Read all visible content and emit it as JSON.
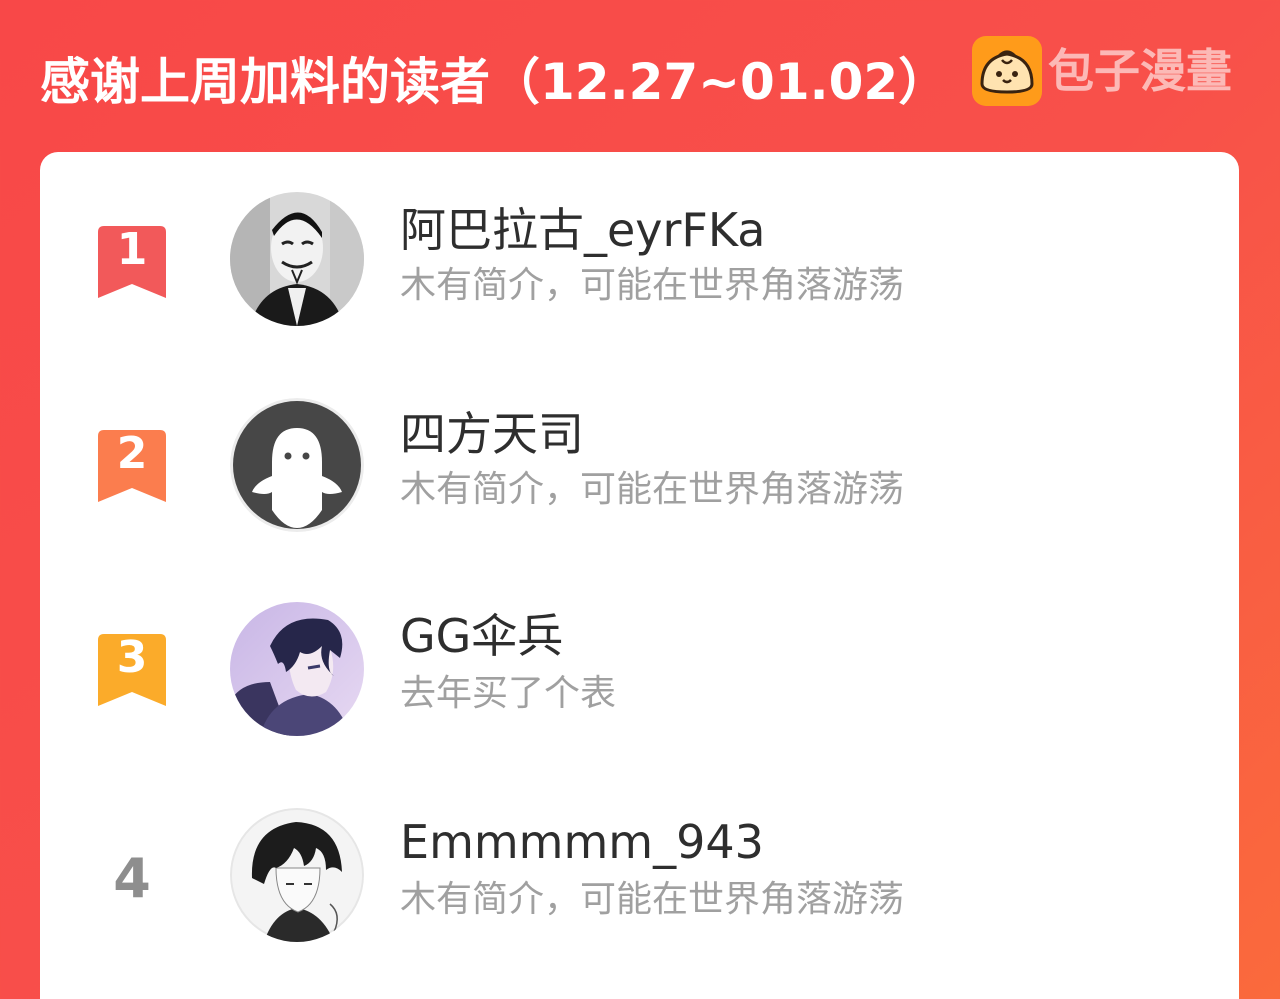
{
  "header": {
    "title": "感谢上周加料的读者（12.27~01.02）",
    "brand_name": "包子漫畫"
  },
  "readers": [
    {
      "rank": "1",
      "name": "阿巴拉古_eyrFKa",
      "bio": "木有简介，可能在世界角落游荡",
      "badge_color": "#f2595a"
    },
    {
      "rank": "2",
      "name": "四方天司",
      "bio": "木有简介，可能在世界角落游荡",
      "badge_color": "#fb7d4e"
    },
    {
      "rank": "3",
      "name": "GG伞兵",
      "bio": "去年买了个表",
      "badge_color": "#fbab2a"
    },
    {
      "rank": "4",
      "name": "Emmmmm_943",
      "bio": "木有简介，可能在世界角落游荡",
      "badge_color": ""
    }
  ],
  "colors": {
    "background": "#f84848",
    "card": "#ffffff",
    "name_text": "#2e2e2e",
    "bio_text": "#a0a0a0",
    "brand_icon": "#ff9b1a"
  },
  "icons": {
    "brand": "steamed-bun-icon",
    "rank_badge": "bookmark-ribbon-icon",
    "avatars": [
      "guy-fawkes-mask-avatar",
      "default-ghost-avatar",
      "anime-boy-avatar",
      "anime-boy-sketch-avatar"
    ]
  }
}
